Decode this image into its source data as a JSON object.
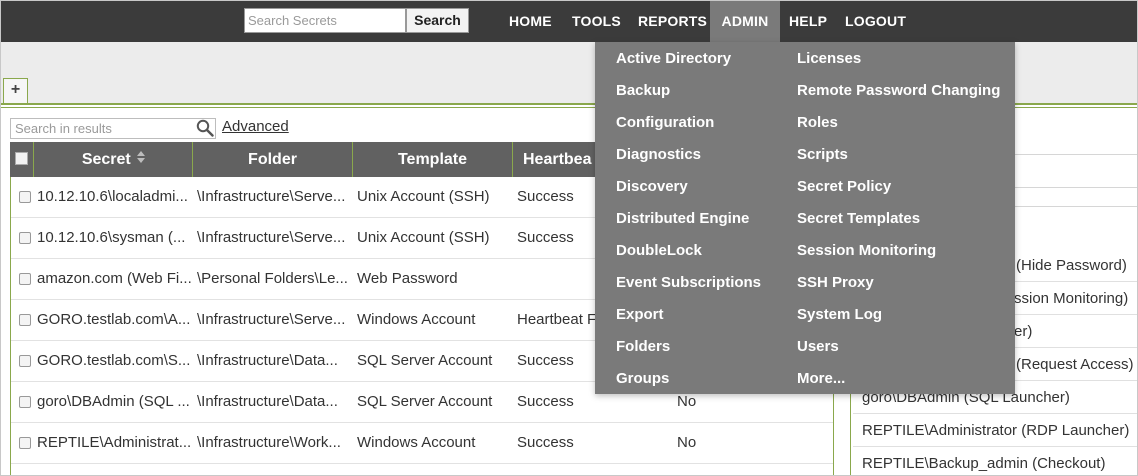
{
  "search": {
    "placeholder": "Search Secrets",
    "button": "Search"
  },
  "nav": {
    "home": "HOME",
    "tools": "TOOLS",
    "reports": "REPORTS",
    "admin": "ADMIN",
    "help": "HELP",
    "logout": "LOGOUT"
  },
  "tabs": {
    "add": "+"
  },
  "results": {
    "placeholder": "Search in results",
    "advanced": "Advanced"
  },
  "table": {
    "headers": {
      "secret": "Secret",
      "folder": "Folder",
      "template": "Template",
      "heartbeat": "Heartbea"
    },
    "rows": [
      {
        "secret": "10.12.10.6\\localadmi...",
        "folder": "\\Infrastructure\\Serve...",
        "template": "Unix Account (SSH)",
        "heartbeat": "Success",
        "extra": ""
      },
      {
        "secret": "10.12.10.6\\sysman (...",
        "folder": "\\Infrastructure\\Serve...",
        "template": "Unix Account (SSH)",
        "heartbeat": "Success",
        "extra": ""
      },
      {
        "secret": "amazon.com (Web Fi...",
        "folder": "\\Personal Folders\\Le...",
        "template": "Web Password",
        "heartbeat": "",
        "extra": ""
      },
      {
        "secret": "GORO.testlab.com\\A...",
        "folder": "\\Infrastructure\\Serve...",
        "template": "Windows Account",
        "heartbeat": "Heartbeat F",
        "extra": ""
      },
      {
        "secret": "GORO.testlab.com\\S...",
        "folder": "\\Infrastructure\\Data...",
        "template": "SQL Server Account",
        "heartbeat": "Success",
        "extra": ""
      },
      {
        "secret": "goro\\DBAdmin (SQL ...",
        "folder": "\\Infrastructure\\Data...",
        "template": "SQL Server Account",
        "heartbeat": "Success",
        "extra": "No"
      },
      {
        "secret": "REPTILE\\Administrat...",
        "folder": "\\Infrastructure\\Work...",
        "template": "Windows Account",
        "heartbeat": "Success",
        "extra": "No"
      }
    ]
  },
  "launchers": [
    "(Hide Password)",
    "ssion Monitoring)",
    "er)",
    "(Request Access)",
    "goro\\DBAdmin (SQL Launcher)",
    "REPTILE\\Administrator (RDP Launcher)",
    "REPTILE\\Backup_admin (Checkout)"
  ],
  "admin_menu": {
    "left": [
      "Active Directory",
      "Backup",
      "Configuration",
      "Diagnostics",
      "Discovery",
      "Distributed Engine",
      "DoubleLock",
      "Event Subscriptions",
      "Export",
      "Folders",
      "Groups"
    ],
    "right": [
      "Licenses",
      "Remote Password Changing",
      "Roles",
      "Scripts",
      "Secret Policy",
      "Secret Templates",
      "Session Monitoring",
      "SSH Proxy",
      "System Log",
      "Users",
      "More..."
    ]
  },
  "colors": {
    "topbar": "#3b3b3b",
    "menu_bg": "#7a7a7a",
    "table_header": "#616161",
    "accent_green": "#8aa84c"
  }
}
